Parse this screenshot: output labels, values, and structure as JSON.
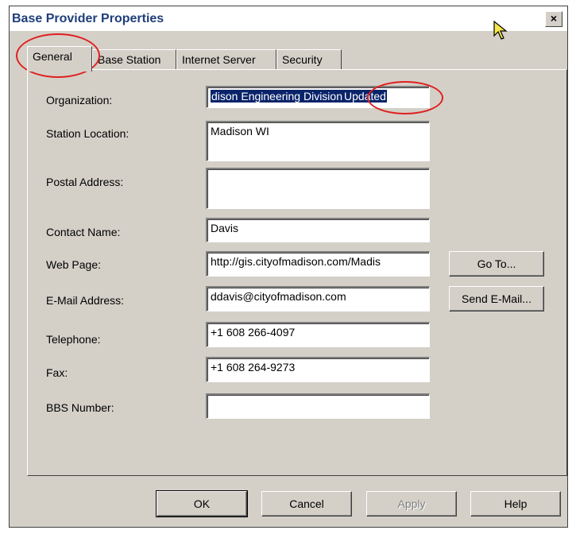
{
  "window": {
    "title": "Base Provider Properties",
    "close_label": "×"
  },
  "tabs": [
    {
      "label": "General",
      "active": true
    },
    {
      "label": "Base Station",
      "active": false
    },
    {
      "label": "Internet Server",
      "active": false
    },
    {
      "label": "Security",
      "active": false
    }
  ],
  "form": {
    "organization": {
      "label": "Organization:",
      "value_prefix": "dison Engineering Division",
      "value_selected": "Updated"
    },
    "station_location": {
      "label": "Station Location:",
      "value": "Madison WI"
    },
    "postal_address": {
      "label": "Postal Address:",
      "value": ""
    },
    "contact_name": {
      "label": "Contact Name:",
      "value": "Davis"
    },
    "web_page": {
      "label": "Web Page:",
      "value": "http://gis.cityofmadison.com/Madis",
      "button": "Go To..."
    },
    "email": {
      "label": "E-Mail Address:",
      "value": "ddavis@cityofmadison.com",
      "button": "Send E-Mail..."
    },
    "telephone": {
      "label": "Telephone:",
      "value": "+1 608 266-4097"
    },
    "fax": {
      "label": "Fax:",
      "value": "+1 608 264-9273"
    },
    "bbs_number": {
      "label": "BBS Number:",
      "value": ""
    }
  },
  "buttons": {
    "ok": "OK",
    "cancel": "Cancel",
    "apply": "Apply",
    "help": "Help"
  },
  "colors": {
    "annotation": "#e02020",
    "selection": "#0a246a",
    "title_text": "#1f3e7c",
    "dialog_bg": "#d4d0c8"
  }
}
